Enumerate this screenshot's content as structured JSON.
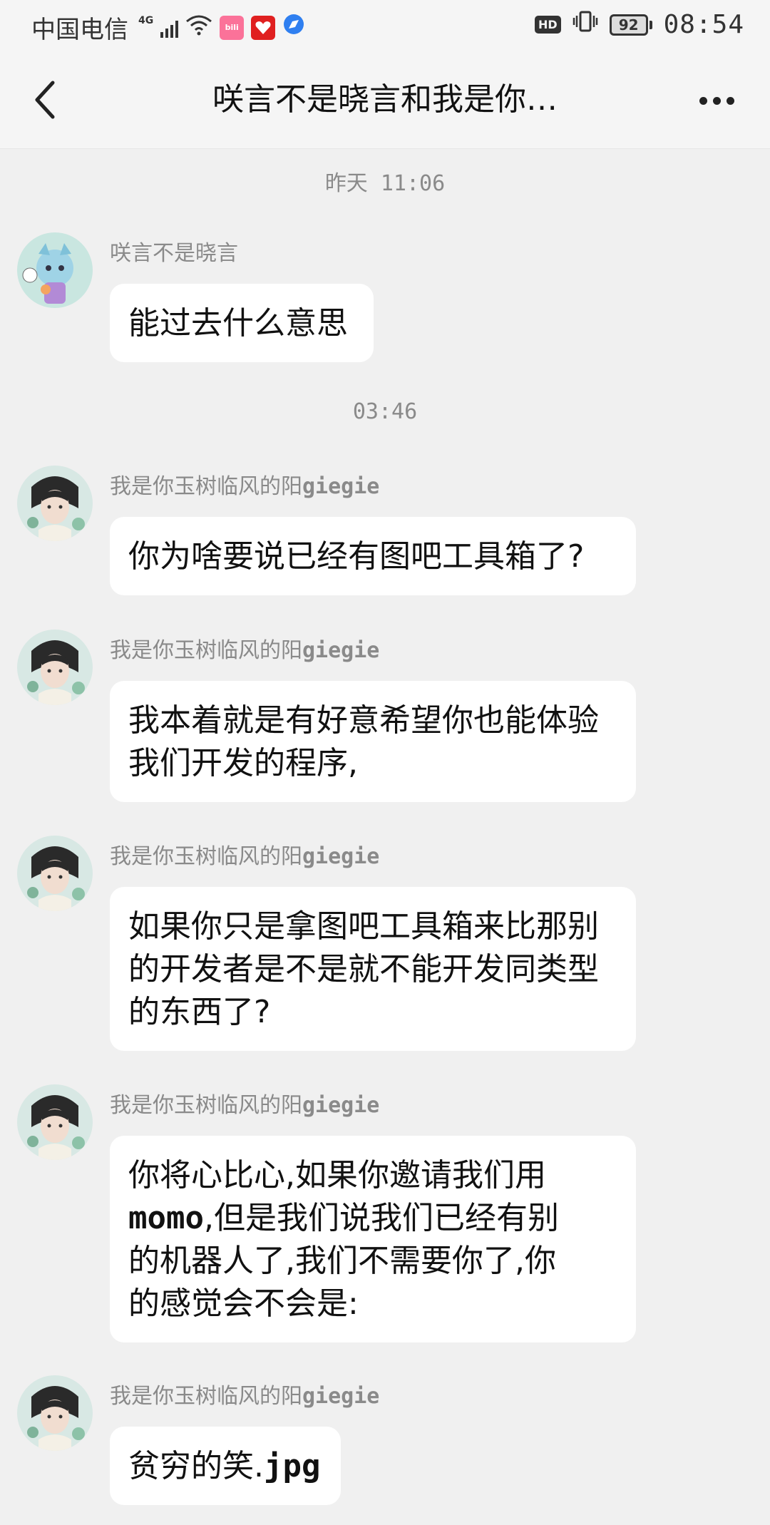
{
  "status_bar": {
    "carrier": "中国电信",
    "network": "4G",
    "battery": "92",
    "time": "08:54",
    "hd": "HD",
    "app_badge_1": "bili",
    "icons": [
      "signal-icon",
      "wifi-icon",
      "bilibili-icon",
      "app-icon",
      "browser-icon",
      "vibrate-icon",
      "battery-icon"
    ]
  },
  "header": {
    "title": "咲言不是晓言和我是你…"
  },
  "timestamps": [
    "昨天 11:06",
    "03:46"
  ],
  "messages": [
    {
      "sender": "咲言不是晓言",
      "text": "能过去什么意思"
    },
    {
      "sender_prefix": "我是你玉树临风的阳",
      "sender_suffix": "giegie",
      "text": "你为啥要说已经有图吧工具箱了?"
    },
    {
      "sender_prefix": "我是你玉树临风的阳",
      "sender_suffix": "giegie",
      "line1": "我本着就是有好意希望你也能体验",
      "line2": "我们开发的程序,"
    },
    {
      "sender_prefix": "我是你玉树临风的阳",
      "sender_suffix": "giegie",
      "line1": "如果你只是拿图吧工具箱来比那别",
      "line2": "的开发者是不是就不能开发同类型",
      "line3": "的东西了?"
    },
    {
      "sender_prefix": "我是你玉树临风的阳",
      "sender_suffix": "giegie",
      "line1": "你将心比心,如果你邀请我们用",
      "line2_mono": "momo",
      "line2_rest": ",但是我们说我们已经有别",
      "line3": "的机器人了,我们不需要你了,你",
      "line4": "的感觉会不会是:"
    },
    {
      "sender_prefix": "我是你玉树临风的阳",
      "sender_suffix": "giegie",
      "text_prefix": "贫穷的笑.",
      "text_mono": "jpg"
    }
  ],
  "colors": {
    "background": "#f0f0f0",
    "bubble": "#ffffff",
    "meta_text": "#8a8a8a"
  }
}
